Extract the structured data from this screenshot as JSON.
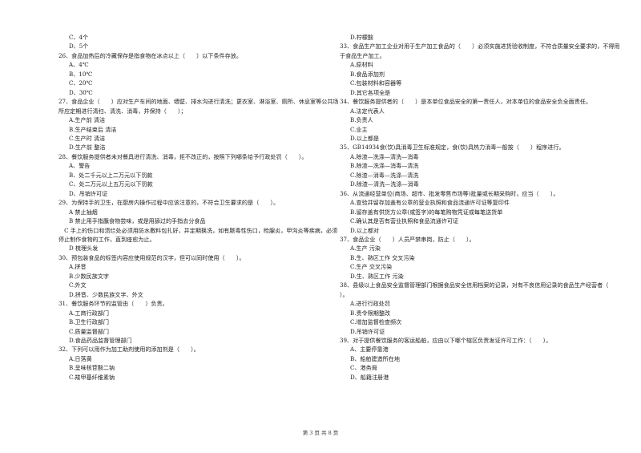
{
  "left_column": [
    {
      "number": "",
      "stem": "",
      "options": [
        "C、4个",
        "D、5个"
      ]
    },
    {
      "number": "26",
      "stem": "26、食品加热后的冷藏保存是指食物在冰点以上（　　）以下条件存放。",
      "options": [
        "A、4℃",
        "B、10℃",
        "C、20℃",
        "D、30℃"
      ]
    },
    {
      "number": "27",
      "stem": "27、食品企业（　　）应对生产车间的地面、墙壁、排水沟进行清洗；更衣室、淋浴室、厕所、休息室等公共场所应定期进行清扫、清洗、消毒，并保持（　　）；",
      "options": [
        "A.生产前 清洁",
        "B.生产结束后 清洁",
        "C.生产时 清洁",
        "D.生产前 整洁"
      ]
    },
    {
      "number": "28",
      "stem": "28、餐饮服务提供者未对餐具进行清洗、消毒，拒不改正的，按照下列哪条给予行政处罚（　　）。",
      "options": [
        "A、警告",
        "B、处二千元以上二万元以下罚款",
        "C、处二万元以上五万元以下罚款",
        "D、吊销许可证"
      ]
    },
    {
      "number": "29",
      "stem": "29、为保持手的卫生，在厨房内操作过程中应该注意的，不符合卫生要求的是（　　）。",
      "options": [
        "A 禁止抽烟",
        "B 禁止用手指蘸食物尝味，或是用舔过的手指去分食品"
      ]
    },
    {
      "number": "",
      "stem": "　C 手上的伤口和溃烂处必须用防水敷料包扎好，并定期换洗，如有脓毒性伤口，睑腺炎，甲沟炎等疾病，必须停止制作食物的工作，直到痊愈为止。",
      "options": [
        "D 梳理头发"
      ]
    },
    {
      "number": "30",
      "stem": "30、预包装食品的标签内容应使用规范的汉字，但可以同时使用（　　）。",
      "options": [
        "A.拼音",
        "B.少数民族文字",
        "C.外文",
        "D.拼音、少数民族文字、外文"
      ]
    },
    {
      "number": "31",
      "stem": "31、餐饮服务环节的监管由（　　）负责。",
      "options": [
        "A.工商行政部门",
        "B.卫生行政部门",
        "C.质量监督部门",
        "D.食品药品监督管理部门"
      ]
    },
    {
      "number": "32",
      "stem": "32、下列可以用作为加工助剂使用的添加剂是（　　）。",
      "options": [
        "A.日落黄",
        "B.呈味核苷酸二钠",
        "C.羧甲基纤维素钠"
      ]
    }
  ],
  "right_column": [
    {
      "number": "",
      "stem": "",
      "options": [
        "D.柠檬酸"
      ]
    },
    {
      "number": "33",
      "stem": "33、食品生产加工企业对用于生产加工食品的（　　）必须实施进货验收制度，不符合质量安全要求的，不得用于食品生产加工。",
      "options": [
        "A.原材料",
        "B.食品添加剂",
        "C.包装材料和容器等",
        "D.其它各项全是"
      ]
    },
    {
      "number": "34",
      "stem": "34、餐饮服务提供者的（　　）是本单位食品安全的第一责任人，对本单位的食品安全负全面责任。",
      "options": [
        "A.法定代表人",
        "B.负责人",
        "C.业主",
        "D.以上都是"
      ]
    },
    {
      "number": "35",
      "stem": "35、GB14934食(饮)具消毒卫生标准规定，食(饮)具热力消毒一般按（　　）程序进行。",
      "options": [
        "A.除渣—洗涤—清洗—消毒",
        "B.除渣—洗涤—消毒—清洗",
        "C.除渣—消毒—洗涤—清洗",
        "D.除渣—清洗—洗涤—消毒"
      ]
    },
    {
      "number": "36",
      "stem": "36、从流通经营单位(商场、超市、批发零售市场等)批量或长期采购时，应当（　　）。",
      "options": [
        "A.查验并留存加盖有公章的营业执照和食品流通许可证等复印件",
        "B.留存盖有供货方公章(或签字)的每笔购物凭证或每笔送货单",
        "C.确认其是否有营业执照和食品流通许可证",
        "D.以上都对"
      ]
    },
    {
      "number": "37",
      "stem": "37、食品企业（　　）人员严禁串岗，防止（　　）。",
      "options": [
        "A.生产 污染",
        "B.生、熟区工作 交叉污染",
        "C.生产 交叉污染",
        "D.生、熟区工作 污染"
      ]
    },
    {
      "number": "38",
      "stem": "38、县级以上食品安全监督管理部门根据食品安全信用档案的记录，对有不良信用记录的食品生产经营者（　　）。",
      "options": [
        "A.进行行政处罚",
        "B.责令限期整改",
        "C.增加监督检查频次",
        "D.吊销许可证"
      ]
    },
    {
      "number": "39",
      "stem": "39、对于提供餐饮服务的客运船舶，应由以下哪个辖区负责发证许可工作：（　　）。",
      "options": [
        "A、主要停靠港",
        "B、船舶建造所在地",
        "C、港务局",
        "D、船籍注册港"
      ]
    }
  ],
  "footer": {
    "page_label": "第 3 页 共 8 页"
  }
}
